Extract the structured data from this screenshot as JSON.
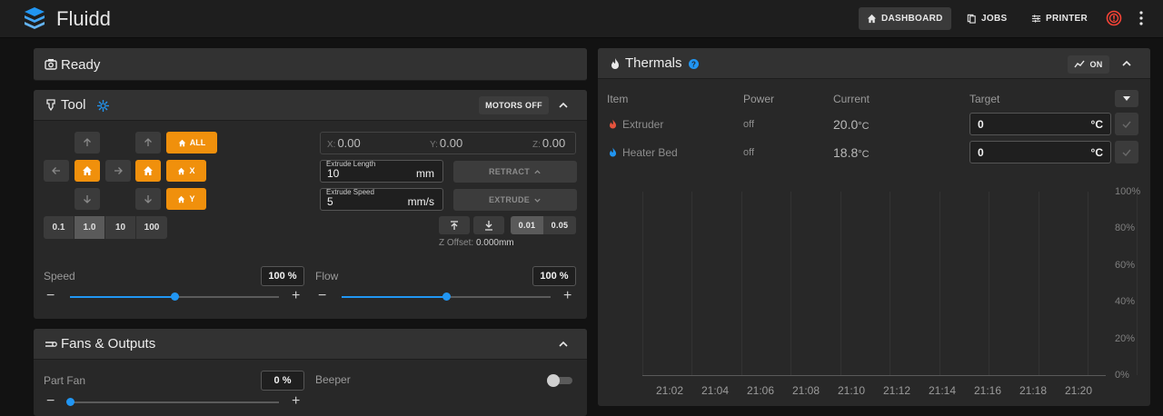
{
  "app": {
    "title": "Fluidd",
    "nav": {
      "dashboard": "DASHBOARD",
      "jobs": "JOBS",
      "printer": "PRINTER"
    }
  },
  "colors": {
    "accent": "#f0900c",
    "primary": "#2196f3",
    "extruder": "#e5533d",
    "bed": "#2196f3"
  },
  "status_card": {
    "title": "Ready"
  },
  "tool_card": {
    "title": "Tool",
    "motors_off": "MOTORS OFF",
    "home_all": "ALL",
    "home_x": "X",
    "home_y": "Y",
    "steps": [
      "0.1",
      "1.0",
      "10",
      "100"
    ],
    "selected_step": "1.0",
    "coords": {
      "x_label": "X:",
      "x": "0.00",
      "y_label": "Y:",
      "y": "0.00",
      "z_label": "Z:",
      "z": "0.00"
    },
    "extrude_length": {
      "label": "Extrude Length",
      "value": "10",
      "unit": "mm"
    },
    "extrude_speed": {
      "label": "Extrude Speed",
      "value": "5",
      "unit": "mm/s"
    },
    "retract": "RETRACT",
    "extrude": "EXTRUDE",
    "z_steps": [
      "0.01",
      "0.05"
    ],
    "z_offset_label": "Z Offset:",
    "z_offset_value": "0.000mm",
    "speed": {
      "label": "Speed",
      "value": "100 %",
      "level": 0.5
    },
    "flow": {
      "label": "Flow",
      "value": "100 %",
      "level": 0.5
    }
  },
  "fans_card": {
    "title": "Fans & Outputs",
    "part_fan": {
      "label": "Part Fan",
      "value": "0 %",
      "level": 0.0
    },
    "beeper": {
      "label": "Beeper",
      "on": false
    }
  },
  "thermals": {
    "title": "Thermals",
    "chart_toggle": "ON",
    "headers": {
      "item": "Item",
      "power": "Power",
      "current": "Current",
      "target": "Target"
    },
    "rows": [
      {
        "name": "Extruder",
        "power": "off",
        "current": "20.0",
        "unit": "°C",
        "target": "0",
        "target_unit": "°C"
      },
      {
        "name": "Heater Bed",
        "power": "off",
        "current": "18.8",
        "unit": "°C",
        "target": "0",
        "target_unit": "°C"
      }
    ]
  },
  "chart_data": {
    "type": "line",
    "x_ticks": [
      "21:02",
      "21:04",
      "21:06",
      "21:08",
      "21:10",
      "21:12",
      "21:14",
      "21:16",
      "21:18",
      "21:20"
    ],
    "y_ticks": [
      "100%",
      "80%",
      "60%",
      "40%",
      "20%",
      "0%"
    ],
    "ylim": [
      0,
      100
    ],
    "series": []
  }
}
